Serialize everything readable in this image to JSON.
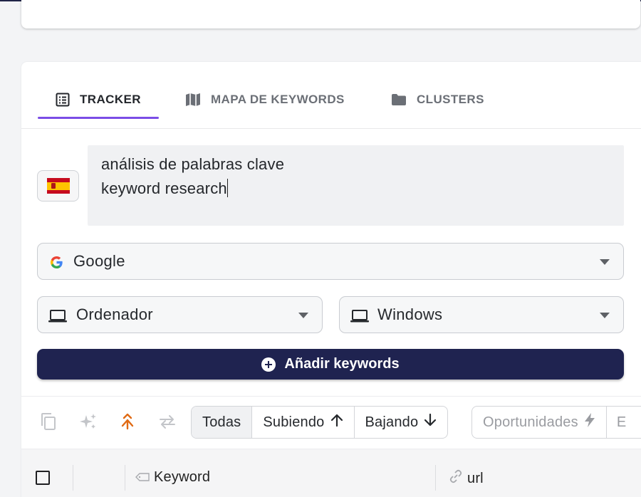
{
  "tabs": [
    {
      "label": "TRACKER",
      "icon": "list-icon",
      "active": true
    },
    {
      "label": "MAPA DE KEYWORDS",
      "icon": "map-icon",
      "active": false
    },
    {
      "label": "CLUSTERS",
      "icon": "folder-icon",
      "active": false
    }
  ],
  "form": {
    "country_flag": "es-flag-icon",
    "keywords_lines": [
      "análisis de palabras clave",
      "keyword research"
    ],
    "search_engine": "Google",
    "device": "Ordenador",
    "os": "Windows",
    "add_button_label": "Añadir keywords"
  },
  "filters": {
    "all": "Todas",
    "rising": "Subiendo",
    "falling": "Bajando",
    "opportunities": "Oportunidades",
    "next_partial": "E"
  },
  "table": {
    "col_keyword": "Keyword",
    "col_url": "url"
  },
  "colors": {
    "accent": "#7b4de6",
    "primary_button": "#1f2350",
    "orange_icon": "#e06a14"
  }
}
